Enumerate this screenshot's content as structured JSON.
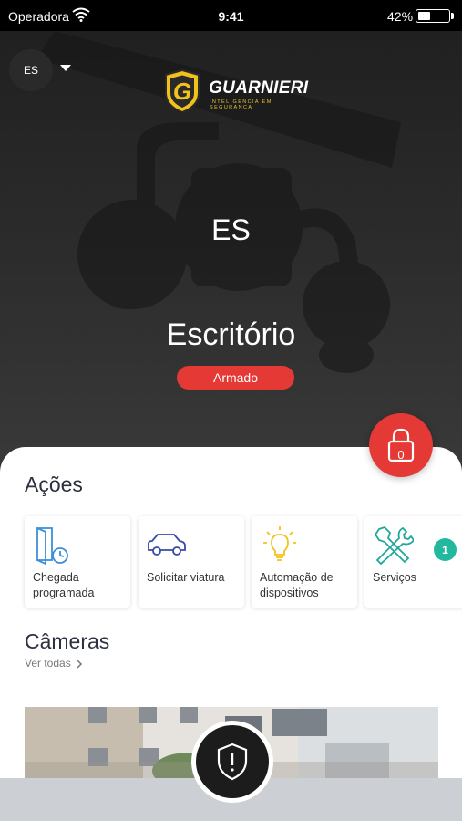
{
  "status_bar": {
    "carrier": "Operadora",
    "time": "9:41",
    "battery_percent": "42%",
    "battery_level": 0.42
  },
  "header": {
    "site_switch_label": "ES",
    "brand_name": "GUARNIERI",
    "brand_tagline": "INTELIGÊNCIA EM SEGURANÇA"
  },
  "site": {
    "code": "ES",
    "name": "Escritório",
    "status": "Armado",
    "status_color": "#e53935"
  },
  "lock": {
    "count": "0"
  },
  "actions": {
    "title": "Ações",
    "items": [
      {
        "label": "Chegada programada",
        "icon": "scheduled-arrival-icon"
      },
      {
        "label": "Solicitar viatura",
        "icon": "car-icon"
      },
      {
        "label": "Automação de dispositivos",
        "icon": "lightbulb-icon"
      },
      {
        "label": "Serviços",
        "icon": "tools-icon",
        "badge": "1"
      }
    ]
  },
  "cameras": {
    "title": "Câmeras",
    "see_all": "Ver todas"
  },
  "colors": {
    "accent_red": "#e53935",
    "badge_teal": "#22b8a0",
    "brand_yellow": "#f2c21b",
    "icon_blue": "#3a8fd8",
    "icon_navy": "#3949ab",
    "icon_teal": "#1fa89a"
  }
}
